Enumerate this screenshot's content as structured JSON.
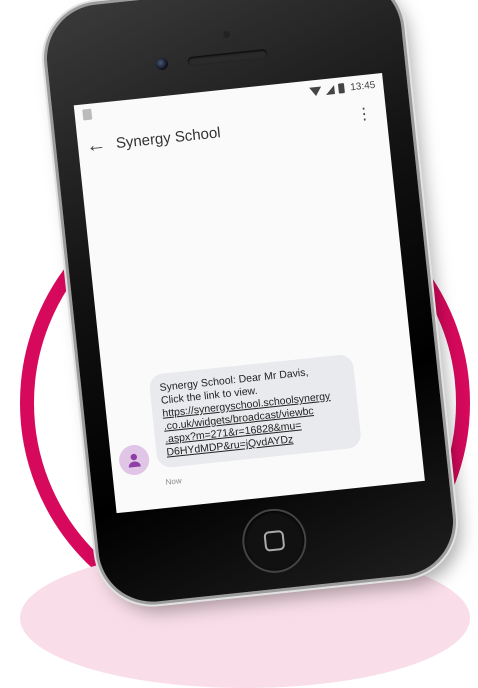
{
  "status_bar": {
    "time": "13:45"
  },
  "app_bar": {
    "contact_name": "Synergy School"
  },
  "message": {
    "intro_line1": "Synergy School: Dear Mr Davis,",
    "intro_line2": "Click the link to view.",
    "link_lines": [
      "https://synergyschool.schoolsynergy",
      ".co.uk/widgets/broadcast/viewbc",
      ".aspx?m=271&r=16828&mu=",
      "D6HYdMDP&ru=jQvdAYDz"
    ],
    "timestamp": "Now"
  },
  "colors": {
    "accent_ring": "#d6095c",
    "bubble": "#e8eaed",
    "avatar": "#e1c5e6"
  },
  "icons": [
    "back-arrow-icon",
    "more-vert-icon",
    "person-icon",
    "wifi-icon",
    "signal-icon",
    "battery-icon"
  ]
}
